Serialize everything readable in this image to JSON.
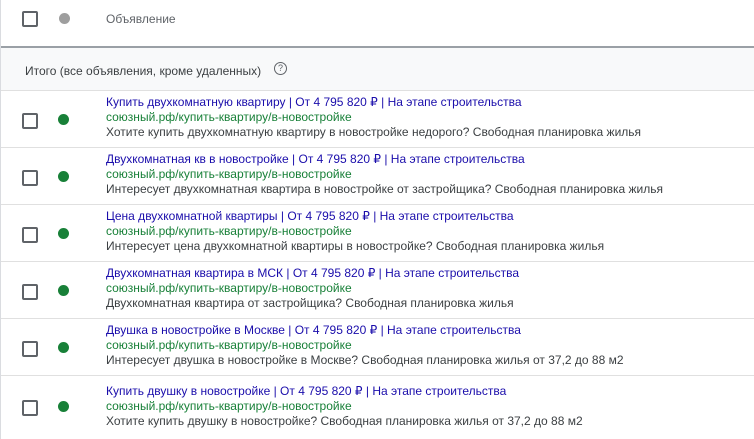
{
  "colors": {
    "active_status": "#188038",
    "header_status": "#9e9e9e"
  },
  "header": {
    "column_title": "Объявление"
  },
  "total": {
    "label": "Итого (все объявления, кроме удаленных)",
    "help_icon": "?"
  },
  "ads": [
    {
      "headline": "Купить двухкомнатную квартиру | От 4 795 820 ₽ | На этапе строительства",
      "url": "союзный.рф/купить-квартиру/в-новостройке",
      "description": "Хотите купить двухкомнатную квартиру в новостройке недорого? Свободная планировка жилья"
    },
    {
      "headline": "Двухкомнатная кв в новостройке | От 4 795 820 ₽ | На этапе строительства",
      "url": "союзный.рф/купить-квартиру/в-новостройке",
      "description": "Интересует двухкомнатная квартира в новостройке от застройщика? Свободная планировка жилья"
    },
    {
      "headline": "Цена двухкомнатной квартиры | От 4 795 820 ₽ | На этапе строительства",
      "url": "союзный.рф/купить-квартиру/в-новостройке",
      "description": "Интересует цена двухкомнатной квартиры в новостройке? Свободная планировка жилья"
    },
    {
      "headline": "Двухкомнатная квартира в МСК | От 4 795 820 ₽ | На этапе строительства",
      "url": "союзный.рф/купить-квартиру/в-новостройке",
      "description": "Двухкомнатная квартира от застройщика? Свободная планировка жилья"
    },
    {
      "headline": "Двушка в новостройке в Москве | От 4 795 820 ₽ | На этапе строительства",
      "url": "союзный.рф/купить-квартиру/в-новостройке",
      "description": "Интересует двушка в новостройке в Москве? Свободная планировка жилья от 37,2 до 88 м2"
    },
    {
      "headline": "Купить двушку в новостройке | От 4 795 820 ₽ | На этапе строительства",
      "url": "союзный.рф/купить-квартиру/в-новостройке",
      "description": "Хотите купить двушку в новостройке? Свободная планировка жилья от 37,2 до 88 м2"
    }
  ]
}
